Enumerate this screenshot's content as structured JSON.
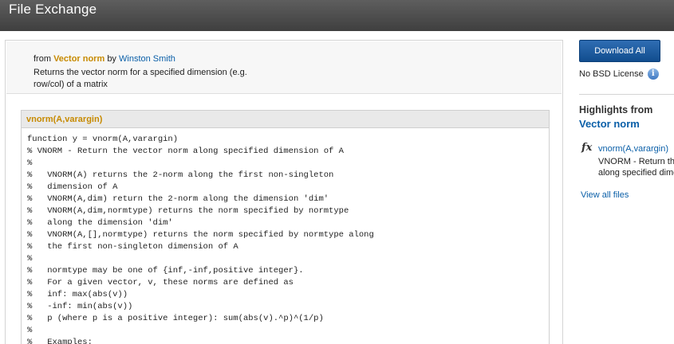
{
  "header": {
    "title": "File Exchange"
  },
  "summary": {
    "from": "from",
    "submission": "Vector norm",
    "by": "by",
    "author": "Winston Smith",
    "description": "Returns the vector norm for a specified dimension (e.g. row/col) of a matrix"
  },
  "file": {
    "name": "vnorm(A,varargin)",
    "code": [
      "function y = vnorm(A,varargin)",
      "% VNORM - Return the vector norm along specified dimension of A",
      "%",
      "%   VNORM(A) returns the 2-norm along the first non-singleton",
      "%   dimension of A",
      "%   VNORM(A,dim) return the 2-norm along the dimension 'dim'",
      "%   VNORM(A,dim,normtype) returns the norm specified by normtype",
      "%   along the dimension 'dim'",
      "%   VNORM(A,[],normtype) returns the norm specified by normtype along",
      "%   the first non-singleton dimension of A",
      "%",
      "%   normtype may be one of {inf,-inf,positive integer}.",
      "%   For a given vector, v, these norms are defined as",
      "%   inf: max(abs(v))",
      "%   -inf: min(abs(v))",
      "%   p (where p is a positive integer): sum(abs(v).^p)^(1/p)",
      "%",
      "%   Examples:"
    ]
  },
  "sidebar": {
    "download_label": "Download All",
    "license_text": "No BSD License",
    "info_glyph": "i",
    "highlights_title": "Highlights from",
    "highlights_submission": "Vector norm",
    "fx_glyph": "fx",
    "highlight_file": "vnorm(A,varargin)",
    "highlight_desc_line1": "VNORM - Return the",
    "highlight_desc_line2": "along specified dime",
    "view_all_label": "View all files"
  }
}
